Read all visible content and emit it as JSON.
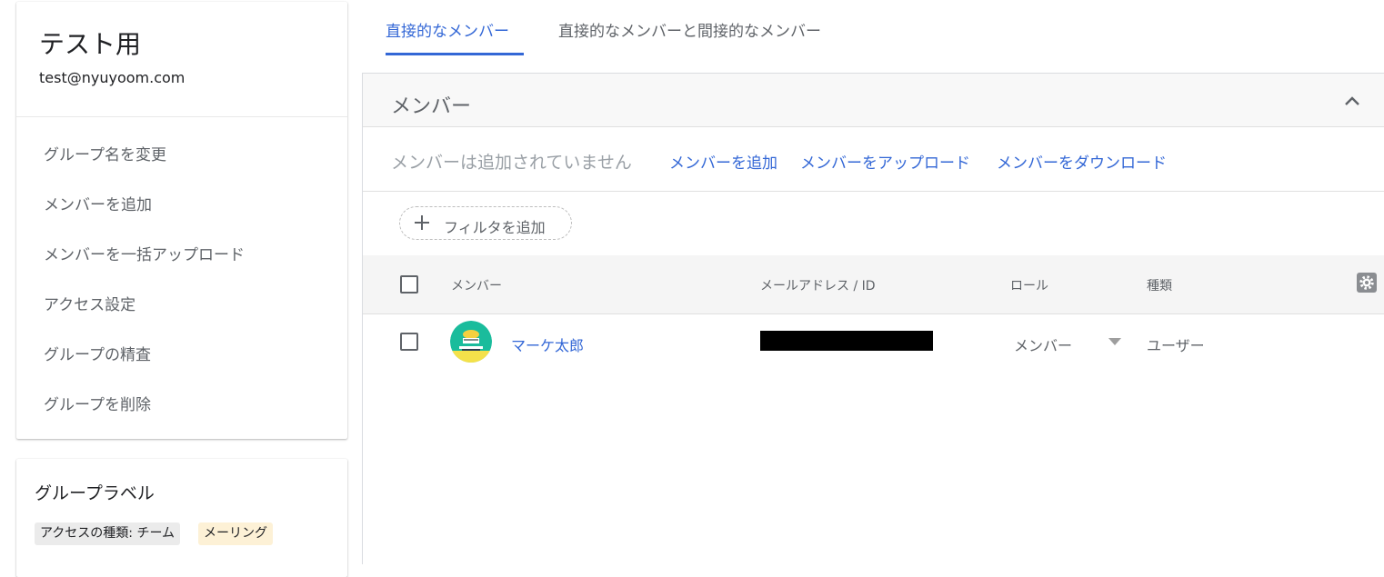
{
  "group": {
    "name": "テスト用",
    "email": "test@nyuyoom.com",
    "menu": [
      {
        "label": "グループ名を変更"
      },
      {
        "label": "メンバーを追加"
      },
      {
        "label": "メンバーを一括アップロード"
      },
      {
        "label": "アクセス設定"
      },
      {
        "label": "グループの精査"
      },
      {
        "label": "グループを削除"
      }
    ]
  },
  "labels": {
    "title": "グループラベル",
    "chips": [
      {
        "label": "アクセスの種類: チーム",
        "color": "#ebebeb"
      },
      {
        "label": "メーリング",
        "color": "#fdf1d6"
      }
    ]
  },
  "tabs": [
    {
      "label": "直接的なメンバー",
      "active": true
    },
    {
      "label": "直接的なメンバーと間接的なメンバー",
      "active": false
    }
  ],
  "members_panel": {
    "title": "メンバー",
    "collapse_icon": "chevron-up-icon",
    "empty_text": "メンバーは追加されていません",
    "actions": [
      {
        "label": "メンバーを追加"
      },
      {
        "label": "メンバーをアップロード"
      },
      {
        "label": "メンバーをダウンロード"
      }
    ],
    "filter": {
      "label": "フィルタを追加",
      "icon": "plus-icon"
    },
    "table": {
      "columns": [
        "メンバー",
        "メールアドレス / ID",
        "ロール",
        "種類"
      ],
      "settings_icon": "gear-icon",
      "rows": [
        {
          "name": "マーケ太郎",
          "email": "",
          "email_redacted": true,
          "role": "メンバー",
          "type": "ユーザー"
        }
      ]
    }
  },
  "colors": {
    "accent": "#3367d6",
    "avatar_bg": "#1abc9c",
    "avatar_figure": "#f4d03f"
  }
}
